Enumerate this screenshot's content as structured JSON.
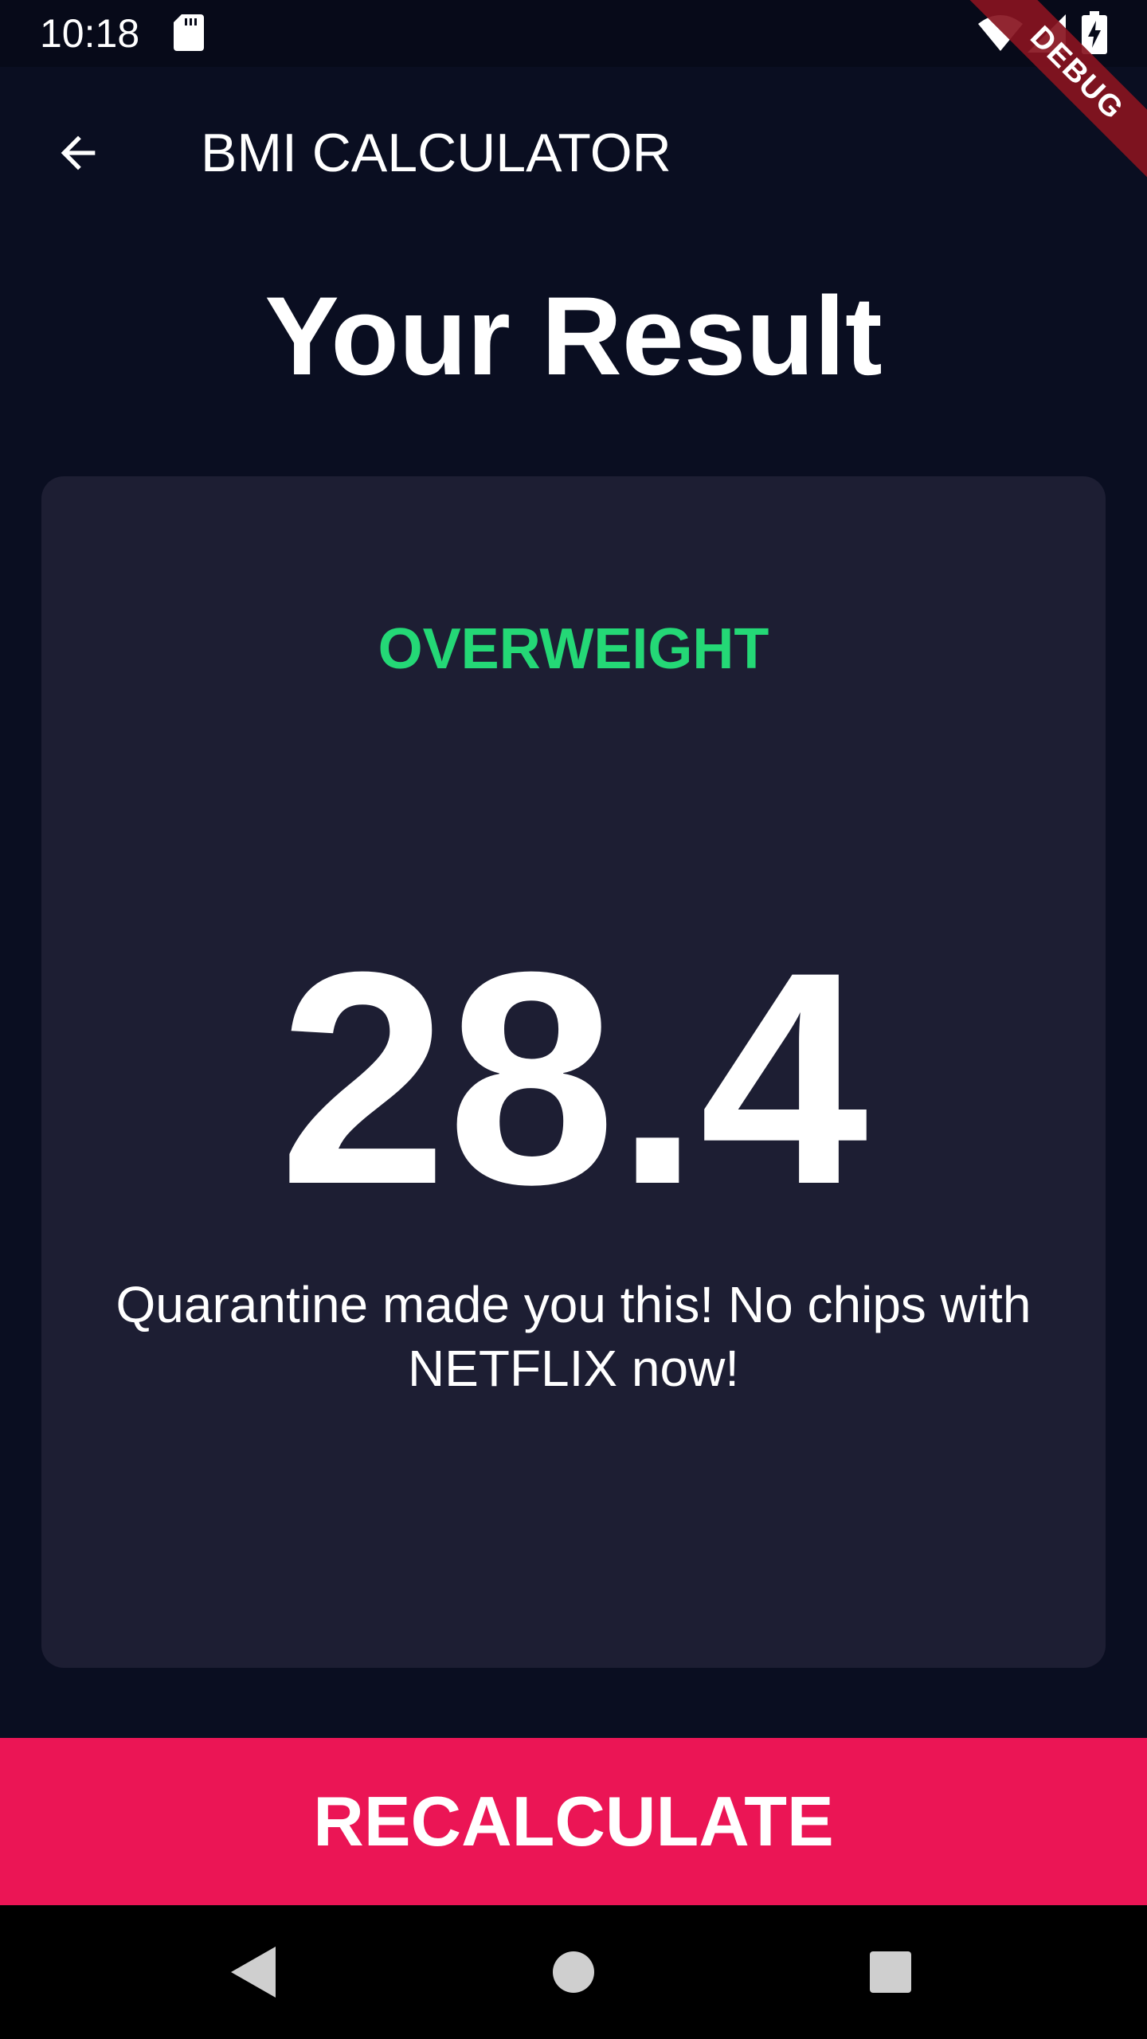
{
  "status_bar": {
    "time": "10:18",
    "icons": [
      "sd-card-icon",
      "wifi-icon",
      "cell-signal-icon",
      "battery-charging-icon"
    ]
  },
  "debug_banner": {
    "label": "DEBUG"
  },
  "app_bar": {
    "title": "BMI CALCULATOR",
    "back_icon": "arrow-back-icon"
  },
  "page": {
    "title": "Your Result"
  },
  "result": {
    "status": "OVERWEIGHT",
    "bmi": "28.4",
    "message": "Quarantine made you this! No chips with NETFLIX now!"
  },
  "actions": {
    "recalculate_label": "RECALCULATE"
  },
  "nav_bar": {
    "icons": [
      "nav-back-icon",
      "nav-home-icon",
      "nav-recents-icon"
    ]
  },
  "colors": {
    "background": "#0a0e21",
    "card": "#1d1e33",
    "accent": "#eb1555",
    "status_green": "#24d876"
  }
}
